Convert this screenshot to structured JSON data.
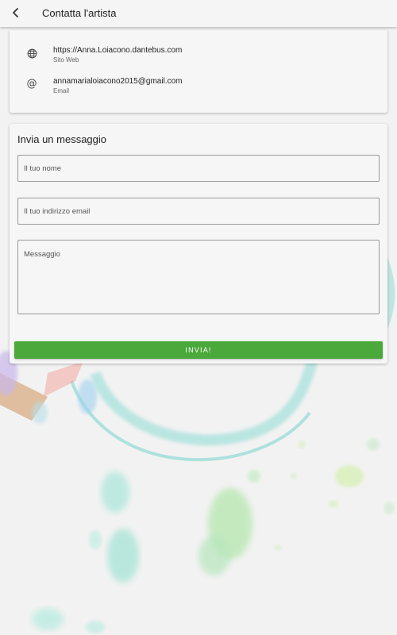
{
  "appbar": {
    "title": "Contatta l'artista",
    "back_icon": "arrow-back-icon"
  },
  "contacts": [
    {
      "icon": "globe-icon",
      "value": "https://Anna.Loiacono.dantebus.com",
      "label": "Sito Web"
    },
    {
      "icon": "at-sign-icon",
      "value": "annamarialoiacono2015@gmail.com",
      "label": "Email"
    }
  ],
  "form": {
    "title": "Invia un messaggio",
    "name_placeholder": "Il tuo nome",
    "email_placeholder": "Il tuo indirizzo email",
    "message_placeholder": "Messaggio",
    "submit_label": "INVIA!"
  },
  "colors": {
    "accent_button": "#4aa93a",
    "background": "#f1f1f1",
    "card": "#f6f6f6"
  }
}
